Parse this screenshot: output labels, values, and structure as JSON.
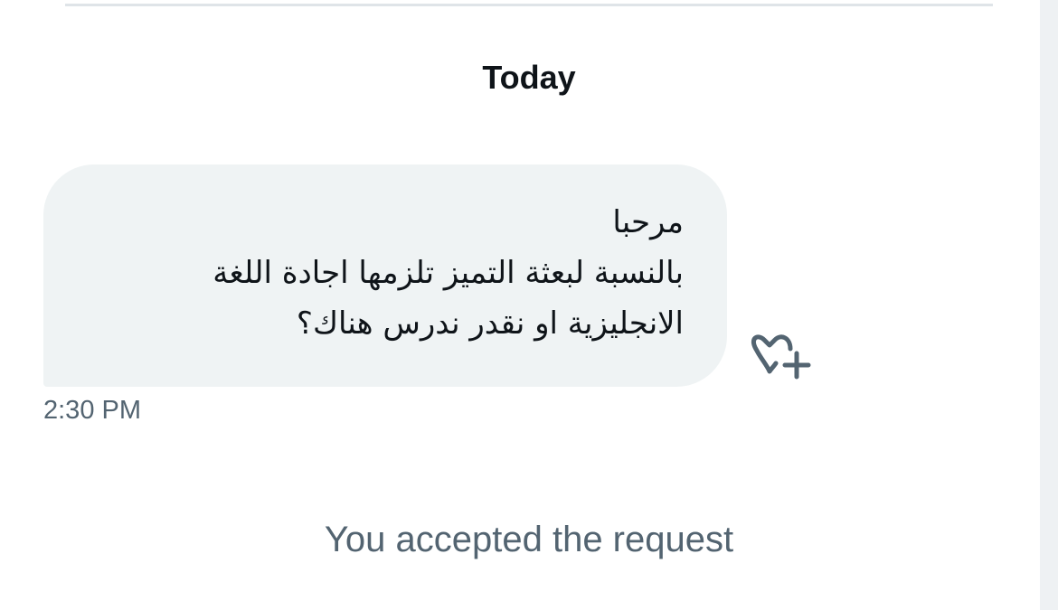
{
  "conversation": {
    "date_header": "Today",
    "message": {
      "text": "مرحبا\nبالنسبة لبعثة التميز تلزمها اجادة اللغة\nالانجليزية او نقدر ندرس هناك؟",
      "time": "2:30 PM"
    },
    "reaction_icon": "heart-plus-icon",
    "system_message": "You accepted the request"
  },
  "colors": {
    "bubble_background": "#eff3f4",
    "primary_text": "#0f1419",
    "secondary_text": "#536471",
    "icon": "#536471",
    "divider": "#dfe4e8"
  }
}
